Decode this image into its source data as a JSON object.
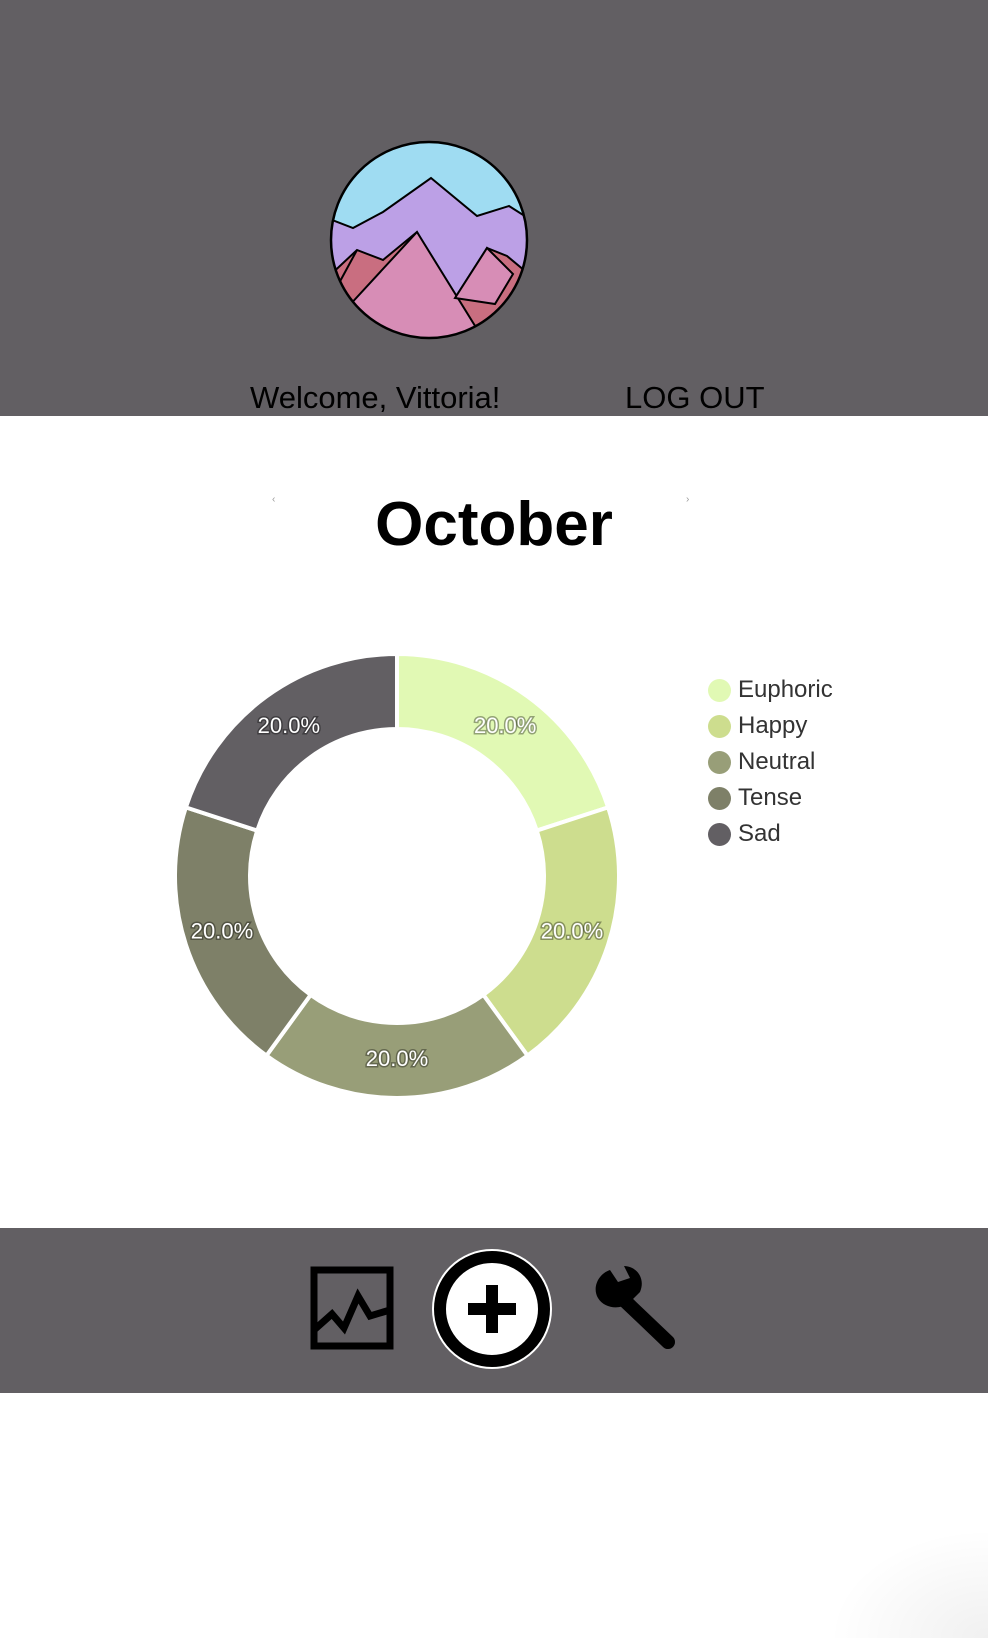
{
  "header": {
    "welcome_text": "Welcome, Vittoria!",
    "logout_label": "LOG OUT",
    "logo_icon": "mountains-logo-icon"
  },
  "month": {
    "title": "October",
    "prev_glyph": "‹",
    "next_glyph": "›"
  },
  "chart_data": {
    "type": "pie",
    "donut": true,
    "categories": [
      "Euphoric",
      "Happy",
      "Neutral",
      "Tense",
      "Sad"
    ],
    "values": [
      20.0,
      20.0,
      20.0,
      20.0,
      20.0
    ],
    "labels": [
      "20.0%",
      "20.0%",
      "20.0%",
      "20.0%",
      "20.0%"
    ],
    "colors": [
      "#e1f9b4",
      "#cddd8e",
      "#989e78",
      "#7e8068",
      "#625f63"
    ],
    "legend_position": "right"
  },
  "legend": [
    {
      "label": "Euphoric",
      "color": "#e1f9b4"
    },
    {
      "label": "Happy",
      "color": "#cddd8e"
    },
    {
      "label": "Neutral",
      "color": "#989e78"
    },
    {
      "label": "Tense",
      "color": "#7e8068"
    },
    {
      "label": "Sad",
      "color": "#625f63"
    }
  ],
  "footer": {
    "nav": [
      {
        "icon": "chart-icon"
      },
      {
        "icon": "add-circle-icon"
      },
      {
        "icon": "wrench-icon"
      }
    ]
  },
  "colors": {
    "bar_bg": "#625f63",
    "sky": "#9fdcf2",
    "mountain_far": "#bca0e6",
    "mountain_near": "#d78db6",
    "mountain_shadow": "#c96e80"
  }
}
